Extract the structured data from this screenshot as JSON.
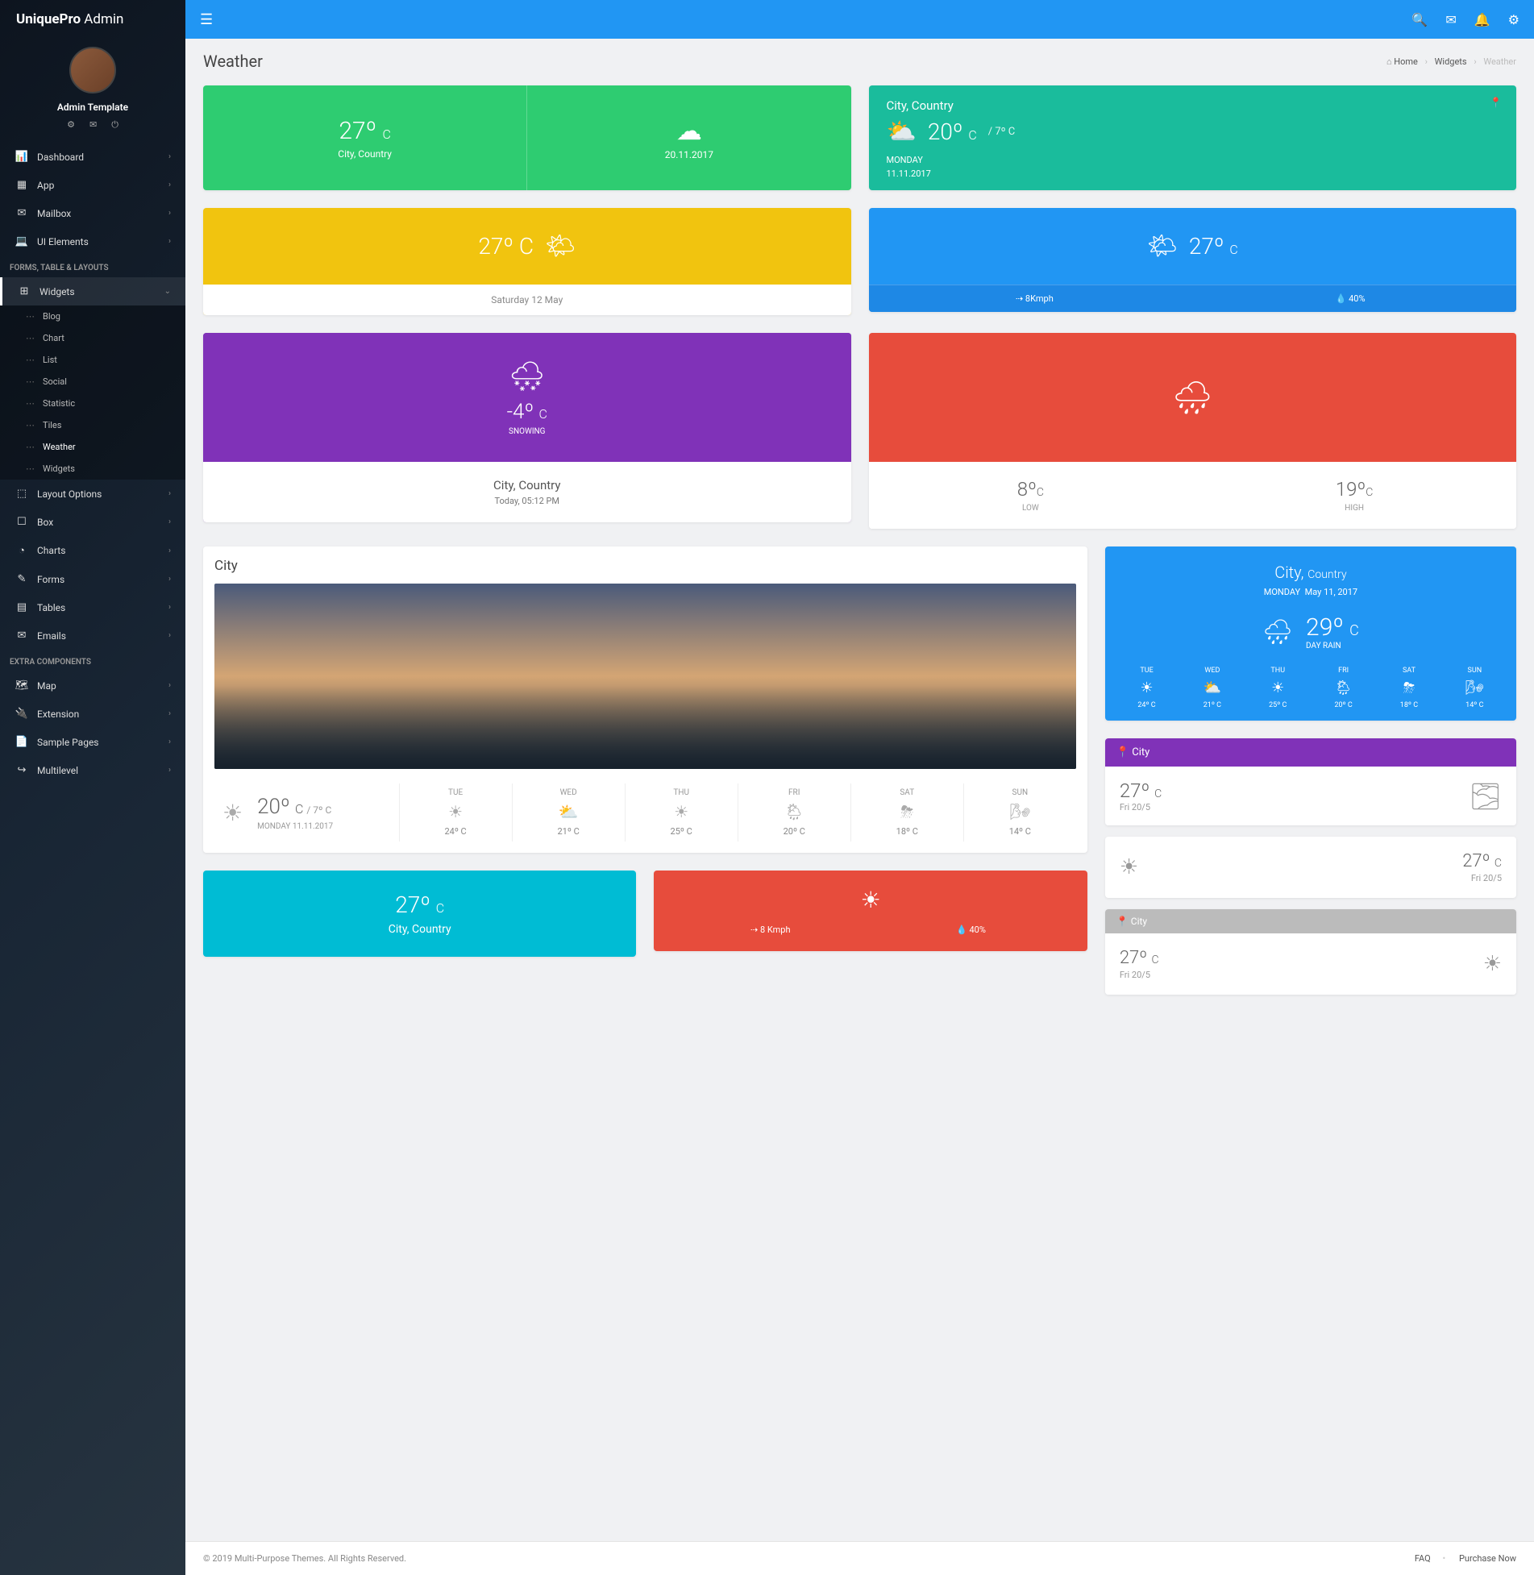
{
  "brand": {
    "bold": "UniquePro",
    "light": " Admin"
  },
  "profile": {
    "name": "Admin Template"
  },
  "nav": {
    "main": [
      "Dashboard",
      "App",
      "Mailbox",
      "UI Elements"
    ],
    "h1": "FORMS, TABLE & LAYOUTS",
    "widgets_label": "Widgets",
    "sub": [
      "Blog",
      "Chart",
      "List",
      "Social",
      "Statistic",
      "Tiles",
      "Weather",
      "Widgets"
    ],
    "rest": [
      "Layout Options",
      "Box",
      "Charts",
      "Forms",
      "Tables",
      "Emails"
    ],
    "h2": "EXTRA COMPONENTS",
    "extra": [
      "Map",
      "Extension",
      "Sample Pages",
      "Multilevel"
    ]
  },
  "page": {
    "title": "Weather"
  },
  "breadcrumb": {
    "home": "Home",
    "widgets": "Widgets",
    "current": "Weather"
  },
  "w1": {
    "temp": "27º ",
    "unit": "C",
    "loc": "City, Country",
    "date": "20.11.2017"
  },
  "w2": {
    "loc": "City, Country",
    "temp": "20º ",
    "unit": "C",
    "min": " / 7º C",
    "day": "MONDAY",
    "date": "11.11.2017"
  },
  "w3": {
    "temp": "27º C",
    "date": "Saturday 12 May"
  },
  "w4": {
    "temp": "27º ",
    "unit": "C",
    "wind": "8Kmph",
    "hum": "40%"
  },
  "w5": {
    "temp": "-4º ",
    "unit": "C",
    "cond": "SNOWING",
    "loc": "City, Country",
    "time": "Today,  05:12 PM"
  },
  "w6": {
    "low_v": "8º",
    "low_u": "C",
    "low_l": "LOW",
    "high_v": "19º",
    "high_u": "C",
    "high_l": "HIGH"
  },
  "w7": {
    "title": "City",
    "today": {
      "temp": "20º ",
      "unit": "C",
      "min": "/ 7º C",
      "date": "MONDAY 11.11.2017"
    },
    "days": [
      {
        "n": "TUE",
        "t": "24º C"
      },
      {
        "n": "WED",
        "t": "21º C"
      },
      {
        "n": "THU",
        "t": "25º C"
      },
      {
        "n": "FRI",
        "t": "20º C"
      },
      {
        "n": "SAT",
        "t": "18º C"
      },
      {
        "n": "SUN",
        "t": "14º C"
      }
    ]
  },
  "w8": {
    "city": "City, ",
    "country": "Country",
    "day": "MONDAY",
    "date": "May 11, 2017",
    "temp": "29º ",
    "unit": "C",
    "cond": "DAY RAIN",
    "days": [
      {
        "n": "TUE",
        "t": "24º C"
      },
      {
        "n": "WED",
        "t": "21º C"
      },
      {
        "n": "THU",
        "t": "25º C"
      },
      {
        "n": "FRI",
        "t": "20º C"
      },
      {
        "n": "SAT",
        "t": "18º C"
      },
      {
        "n": "SUN",
        "t": "14º C"
      }
    ]
  },
  "w9": {
    "temp": "27º ",
    "unit": "C",
    "loc": "City, Country"
  },
  "w10": {
    "wind": "8 Kmph",
    "hum": "40%"
  },
  "w11": {
    "title": "City",
    "temp": "27º ",
    "unit": "C",
    "date": "Fri 20/5"
  },
  "w12": {
    "temp": "27º ",
    "unit": "C",
    "date": "Fri 20/5"
  },
  "w13": {
    "title": "City",
    "temp": "27º ",
    "unit": "C",
    "date": "Fri 20/5"
  },
  "footer": {
    "copy": "© 2019 Multi-Purpose Themes. All Rights Reserved.",
    "faq": "FAQ",
    "buy": "Purchase Now"
  }
}
